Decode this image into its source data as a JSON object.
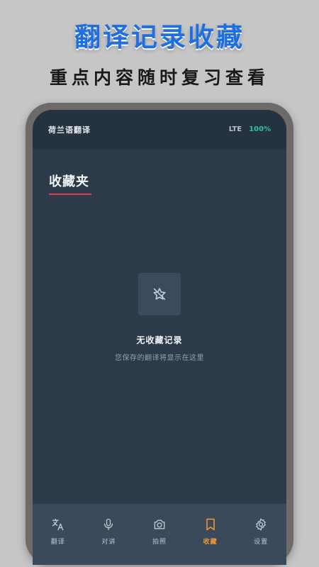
{
  "promo": {
    "title": "翻译记录收藏",
    "subtitle": "重点内容随时复习查看"
  },
  "status_bar": {
    "app_name": "荷兰语翻译",
    "network": "LTE",
    "battery": "100%"
  },
  "page": {
    "title": "收藏夹"
  },
  "empty_state": {
    "icon": "star-off-icon",
    "title": "无收藏记录",
    "description": "您保存的翻译将显示在这里"
  },
  "tab_bar": {
    "tabs": [
      {
        "label": "翻译",
        "icon": "translate-icon",
        "active": false
      },
      {
        "label": "对讲",
        "icon": "microphone-icon",
        "active": false
      },
      {
        "label": "拍照",
        "icon": "camera-icon",
        "active": false
      },
      {
        "label": "收藏",
        "icon": "bookmark-icon",
        "active": true
      },
      {
        "label": "设置",
        "icon": "gear-icon",
        "active": false
      }
    ]
  },
  "colors": {
    "accent": "#f09a32",
    "title_underline": "#d9424a",
    "battery": "#2bc4a0",
    "promo_title": "#1f6fe0"
  }
}
